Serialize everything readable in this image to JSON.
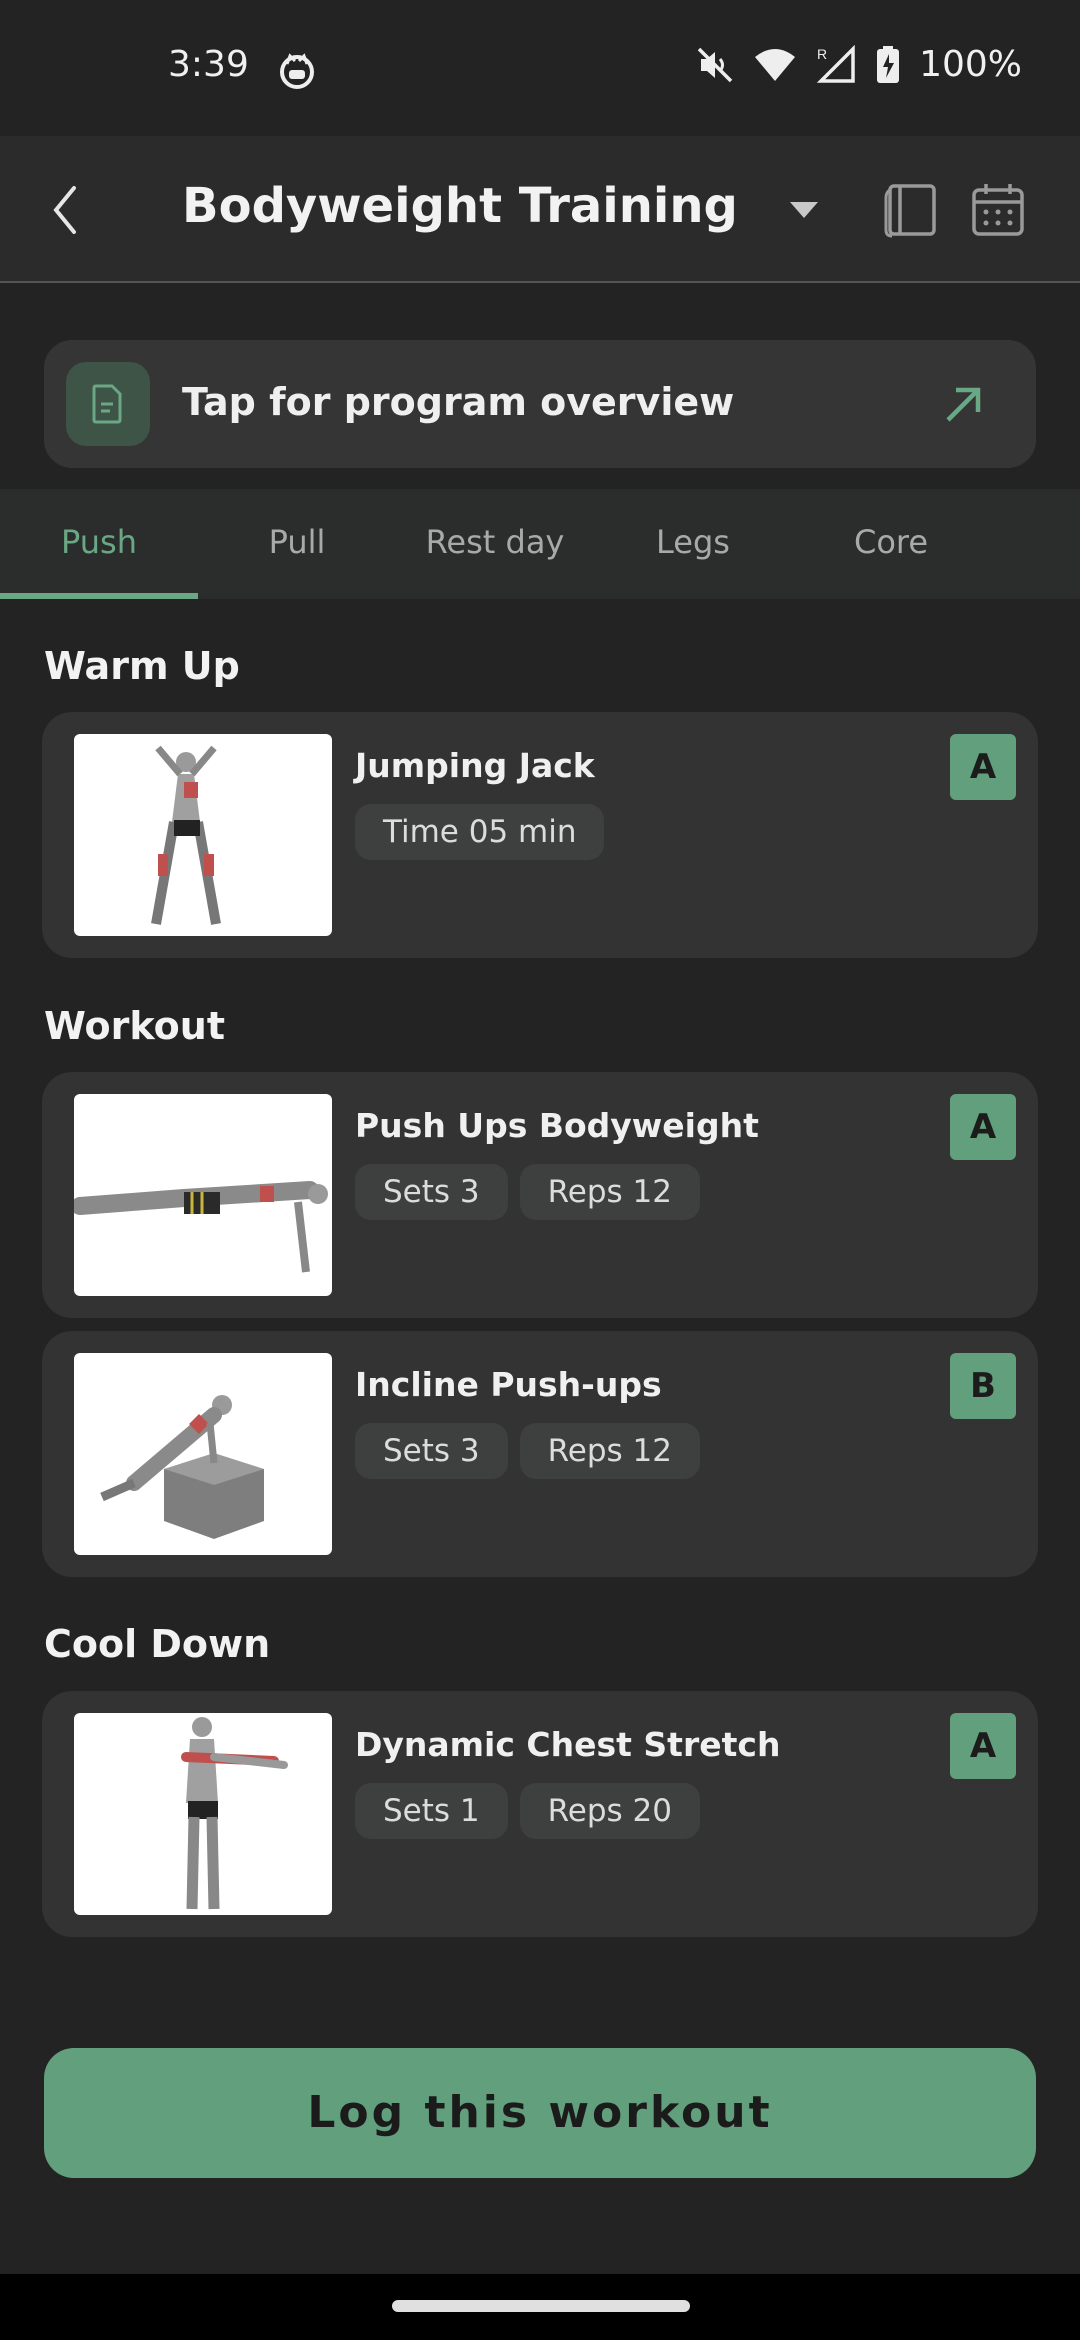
{
  "status_bar": {
    "time": "3:39",
    "battery": "100%"
  },
  "app_bar": {
    "title": "Bodyweight Training"
  },
  "overview": {
    "label": "Tap for program overview"
  },
  "tabs": [
    {
      "label": "Push"
    },
    {
      "label": "Pull"
    },
    {
      "label": "Rest day"
    },
    {
      "label": "Legs"
    },
    {
      "label": "Core"
    }
  ],
  "sections": {
    "warm_up": "Warm Up",
    "workout": "Workout",
    "cool_down": "Cool Down"
  },
  "exercises": [
    {
      "name": "Jumping Jack",
      "chips": [
        "Time 05 min"
      ],
      "badge": "A"
    },
    {
      "name": "Push Ups Bodyweight",
      "chips": [
        "Sets 3",
        "Reps 12"
      ],
      "badge": "A"
    },
    {
      "name": "Incline Push-ups",
      "chips": [
        "Sets 3",
        "Reps 12"
      ],
      "badge": "B"
    },
    {
      "name": "Dynamic Chest Stretch",
      "chips": [
        "Sets 1",
        "Reps 20"
      ],
      "badge": "A"
    }
  ],
  "log_button": {
    "label": "Log this workout"
  },
  "colors": {
    "accent": "#62a07d",
    "tab_active": "#6aa784",
    "background": "#232323",
    "card": "#333333"
  }
}
